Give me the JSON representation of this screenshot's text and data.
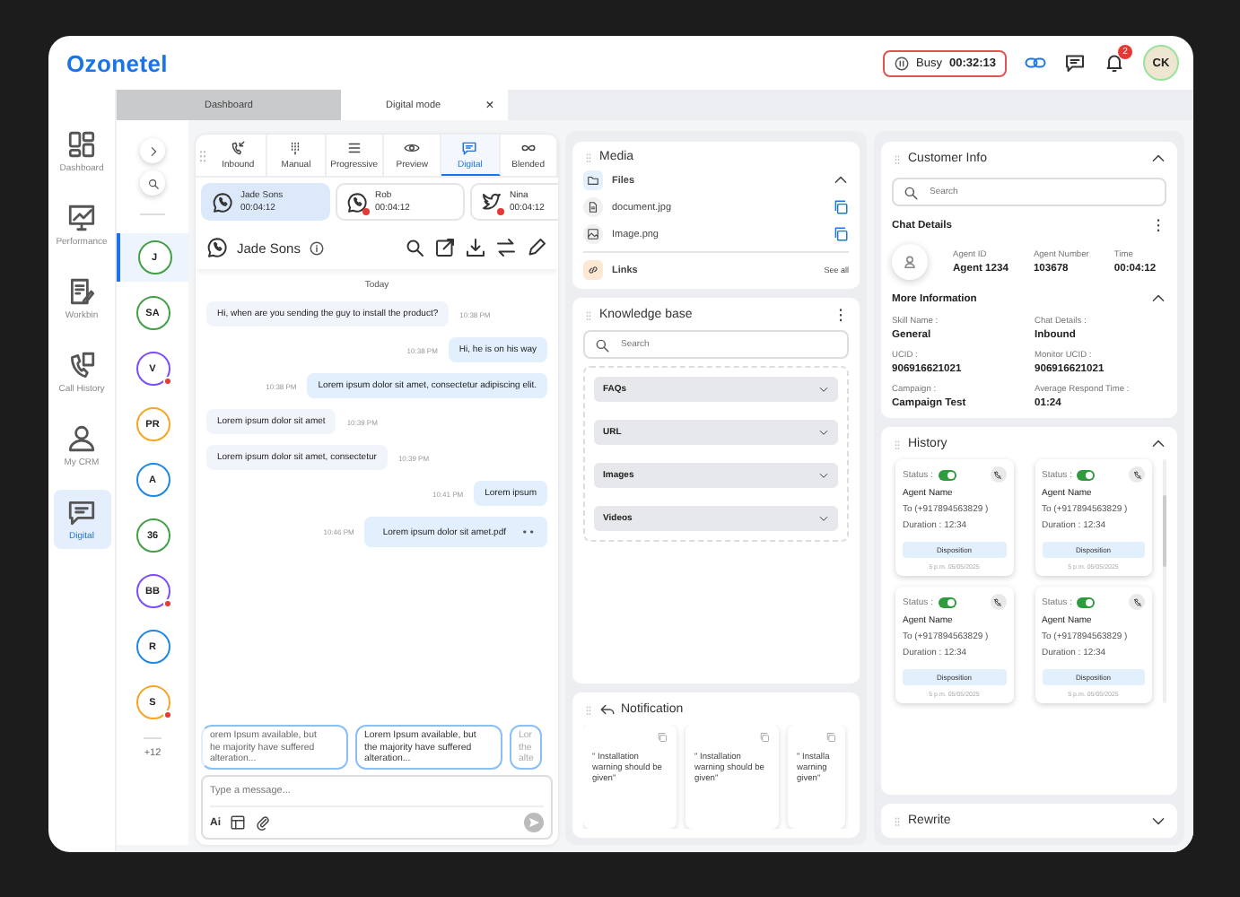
{
  "header": {
    "logo": "Ozonetel",
    "status": {
      "label": "Busy",
      "timer": "00:32:13"
    },
    "notification_count": "2",
    "avatar": "CK"
  },
  "page_tabs": [
    {
      "label": "Dashboard",
      "selected": false
    },
    {
      "label": "Digital mode",
      "selected": true,
      "close": "×"
    }
  ],
  "nav": [
    {
      "label": "Dashboard",
      "kind": "dashboard",
      "selected": false
    },
    {
      "label": "Performance",
      "kind": "performance",
      "selected": false
    },
    {
      "label": "Workbin",
      "kind": "workbin",
      "selected": false
    },
    {
      "label": "Call History",
      "kind": "history",
      "selected": false
    },
    {
      "label": "My CRM",
      "kind": "crm",
      "selected": false
    },
    {
      "label": "Digital",
      "kind": "digital",
      "selected": true
    }
  ],
  "contacts": {
    "items": [
      {
        "initials": "J",
        "color": "#43a047",
        "selected": true,
        "unread": false
      },
      {
        "initials": "SA",
        "color": "#43a047",
        "selected": false,
        "unread": false
      },
      {
        "initials": "V",
        "color": "#7c4dff",
        "selected": false,
        "unread": true
      },
      {
        "initials": "PR",
        "color": "#f5a623",
        "selected": false,
        "unread": false
      },
      {
        "initials": "A",
        "color": "#1e88e5",
        "selected": false,
        "unread": false
      },
      {
        "initials": "36",
        "color": "#43a047",
        "selected": false,
        "unread": false
      },
      {
        "initials": "BB",
        "color": "#7c4dff",
        "selected": false,
        "unread": true
      },
      {
        "initials": "R",
        "color": "#1e88e5",
        "selected": false,
        "unread": false
      },
      {
        "initials": "S",
        "color": "#f5a623",
        "selected": false,
        "unread": true
      }
    ],
    "more": "+12"
  },
  "chat": {
    "modes": [
      {
        "label": "Inbound",
        "kind": "inbound",
        "selected": false
      },
      {
        "label": "Manual",
        "kind": "manual",
        "selected": false
      },
      {
        "label": "Progressive",
        "kind": "progressive",
        "selected": false
      },
      {
        "label": "Preview",
        "kind": "preview",
        "selected": false
      },
      {
        "label": "Digital",
        "kind": "digital",
        "selected": true
      },
      {
        "label": "Blended",
        "kind": "blended",
        "selected": false
      }
    ],
    "conversations": [
      {
        "name": "Jade Sons",
        "time": "00:04:12",
        "kind": "phone",
        "selected": true,
        "unread": false
      },
      {
        "name": "Rob",
        "time": "00:04:12",
        "kind": "phone",
        "selected": false,
        "unread": true
      },
      {
        "name": "Nina",
        "time": "00:04:12",
        "kind": "bird",
        "selected": false,
        "unread": true
      }
    ],
    "contact_name": "Jade Sons",
    "date": "Today",
    "messages": [
      {
        "text": "Hi, when are you sending the guy to install the product?",
        "time": "10:38 PM",
        "kind": "incoming"
      },
      {
        "text": "Hi, he is on his way",
        "time": "10:38 PM",
        "kind": "outgoing"
      },
      {
        "text": "Lorem ipsum dolor sit amet, consectetur adipiscing elit.",
        "time": "10:38 PM",
        "kind": "outgoing"
      },
      {
        "text": "Lorem ipsum dolor sit amet",
        "time": "10:39 PM",
        "kind": "incoming"
      },
      {
        "text": "Lorem ipsum dolor sit amet, consectetur",
        "time": "10:39 PM",
        "kind": "incoming"
      },
      {
        "text": "Lorem ipsum",
        "time": "10:41 PM",
        "kind": "outgoing"
      },
      {
        "text": "Lorem ipsum dolor sit amet.pdf",
        "time": "10:46 PM",
        "kind": "file"
      }
    ],
    "suggestions": [
      {
        "text": "orem Ipsum available, but\nhe majority have suffered\nalteration...",
        "kind": "faded"
      },
      {
        "text": "Lorem Ipsum available, but\nthe majority have suffered\nalteration...",
        "kind": "full"
      },
      {
        "text": "Lor\nthe\nalte",
        "kind": "cut"
      }
    ],
    "composer": {
      "placeholder": "Type a message...",
      "ai": "Ai"
    }
  },
  "media": {
    "title": "Media",
    "files_label": "Files",
    "files": [
      {
        "name": "document.jpg",
        "kind": "document"
      },
      {
        "name": "Image.png",
        "kind": "image"
      }
    ],
    "links_label": "Links",
    "see_all": "See all"
  },
  "knowledge_base": {
    "title": "Knowledge base",
    "search_placeholder": "Search",
    "sections": [
      {
        "label": "FAQs",
        "expanded": false
      },
      {
        "label": "URL",
        "expanded": false
      },
      {
        "label": "Images",
        "expanded": false
      },
      {
        "label": "Videos",
        "expanded": false
      }
    ]
  },
  "notification": {
    "title": "Notification",
    "cards": [
      {
        "text": "\" Installation\nwarning should be\ngiven\"",
        "kind": "full"
      },
      {
        "text": "\" Installation\nwarning should be\ngiven\"",
        "kind": "full"
      },
      {
        "text": "\" Installa\nwarning\ngiven\"",
        "kind": "cut"
      }
    ]
  },
  "customer_info": {
    "title": "Customer Info",
    "search_placeholder": "Search",
    "chat_details_title": "Chat Details",
    "agent": [
      {
        "label": "Agent ID",
        "value": "Agent 1234"
      },
      {
        "label": "Agent Number",
        "value": "103678"
      },
      {
        "label": "Time",
        "value": "00:04:12"
      }
    ],
    "more_info_title": "More Information",
    "fields": [
      {
        "label": "Skill Name :",
        "value": "General"
      },
      {
        "label": "Chat Details :",
        "value": "Inbound"
      },
      {
        "label": "UCID :",
        "value": "906916621021"
      },
      {
        "label": "Monitor UCID :",
        "value": "906916621021"
      },
      {
        "label": "Campaign :",
        "value": "Campaign Test"
      },
      {
        "label": "Average Respond Time :",
        "value": "01:24"
      }
    ]
  },
  "history": {
    "title": "History",
    "cards": [
      {
        "status_label": "Status :",
        "status_on": true,
        "agent": "Agent Name",
        "to": "To (+917894563829 )",
        "duration": "Duration : 12:34",
        "disposition": "Disposition",
        "date": "5 p.m. 05/05/2025"
      },
      {
        "status_label": "Status :",
        "status_on": true,
        "agent": "Agent Name",
        "to": "To (+917894563829 )",
        "duration": "Duration : 12:34",
        "disposition": "Disposition",
        "date": "5 p.m. 05/05/2025"
      },
      {
        "status_label": "Status :",
        "status_on": true,
        "agent": "Agent Name",
        "to": "To (+917894563829 )",
        "duration": "Duration : 12:34",
        "disposition": "Disposition",
        "date": "5 p.m. 05/05/2025"
      },
      {
        "status_label": "Status :",
        "status_on": true,
        "agent": "Agent Name",
        "to": "To (+917894563829 )",
        "duration": "Duration : 12:34",
        "disposition": "Disposition",
        "date": "5 p.m. 05/05/2025"
      }
    ]
  },
  "rewrite": {
    "title": "Rewrite"
  }
}
